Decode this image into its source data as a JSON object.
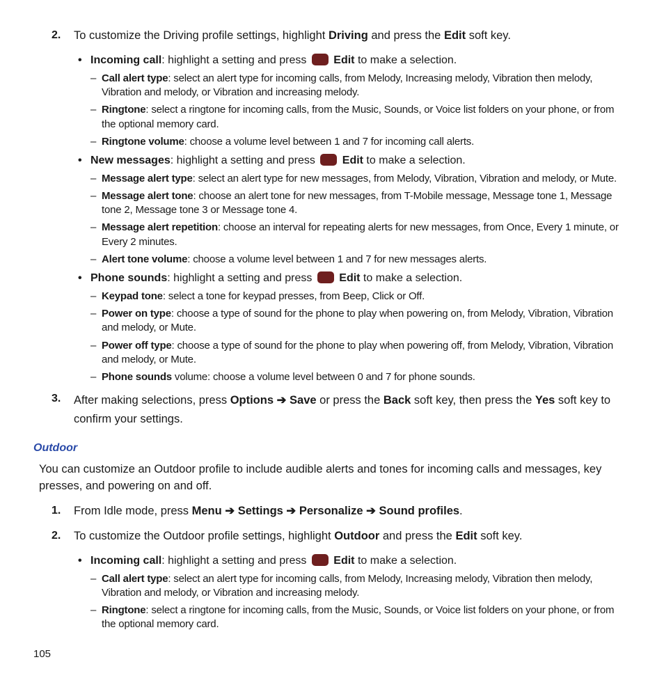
{
  "step2": {
    "num": "2.",
    "pre": "To customize the Driving profile settings, highlight ",
    "bold": "Driving",
    "mid": " and press the ",
    "bold2": "Edit",
    "post": " soft key."
  },
  "incoming": {
    "label": "Incoming call",
    "text1": ": highlight a setting and press ",
    "edit": "Edit",
    "text2": " to make a selection."
  },
  "d_callalert": {
    "label": "Call alert type",
    "text": ": select an alert type for incoming calls, from Melody, Increasing melody, Vibration then melody, Vibration and melody, or Vibration and increasing melody."
  },
  "d_ringtone": {
    "label": "Ringtone",
    "text": ": select a ringtone for incoming calls, from the Music, Sounds, or Voice list folders on your phone, or from the optional memory card."
  },
  "d_ringvol": {
    "label": "Ringtone volume",
    "text": ": choose a volume level between 1 and 7 for incoming call alerts."
  },
  "newmsg": {
    "label": "New messages",
    "text1": ": highlight a setting and press ",
    "edit": "Edit",
    "text2": " to make a selection."
  },
  "d_msgalert": {
    "label": "Message alert type",
    "text": ": select an alert type for new messages, from Melody, Vibration, Vibration and melody, or Mute."
  },
  "d_msgtone": {
    "label": "Message alert tone",
    "text": ": choose an alert tone for new messages, from T-Mobile message, Message tone 1, Message tone 2, Message tone 3 or Message tone 4."
  },
  "d_msgrep": {
    "label": "Message alert repetition",
    "text": ": choose an interval for repeating alerts for new messages, from Once, Every 1 minute, or Every 2 minutes."
  },
  "d_alertvol": {
    "label": "Alert tone volume",
    "text": ": choose a volume level between 1 and 7 for new messages alerts."
  },
  "phonesnd": {
    "label": "Phone sounds",
    "text1": ": highlight a setting and press ",
    "edit": "Edit",
    "text2": " to make a selection."
  },
  "d_keypad": {
    "label": "Keypad tone",
    "text": ": select a tone for keypad presses, from Beep, Click or Off."
  },
  "d_pon": {
    "label": "Power on type",
    "text": ": choose a type of sound for the phone to play when powering on, from Melody, Vibration, Vibration and melody, or Mute."
  },
  "d_poff": {
    "label": "Power off type",
    "text": ": choose a type of sound for the phone to play when powering off, from Melody, Vibration, Vibration and melody, or Mute."
  },
  "d_psvol": {
    "label": "Phone sounds",
    "text": " volume: choose a volume level between 0 and 7 for phone sounds."
  },
  "step3": {
    "num": "3.",
    "pre": "After making selections, press ",
    "opt": "Options",
    "arrow": " ➔ ",
    "save": "Save",
    "mid": " or press the ",
    "back": "Back",
    "mid2": " soft key, then press the ",
    "yes": "Yes",
    "post": " soft key to confirm your settings."
  },
  "outdoor_title": "Outdoor",
  "outdoor_para": "You can customize an Outdoor profile to include audible alerts and tones for incoming calls and messages, key presses, and powering on and off.",
  "ostep1": {
    "num": "1.",
    "pre": "From Idle mode, press ",
    "menu": "Menu",
    "arrow": " ➔ ",
    "settings": "Settings",
    "personalize": "Personalize",
    "sound": "Sound profiles",
    "dot": "."
  },
  "ostep2": {
    "num": "2.",
    "pre": "To customize the Outdoor profile settings, highlight ",
    "bold": "Outdoor",
    "mid": " and press the ",
    "bold2": "Edit",
    "post": " soft key."
  },
  "page": "105"
}
